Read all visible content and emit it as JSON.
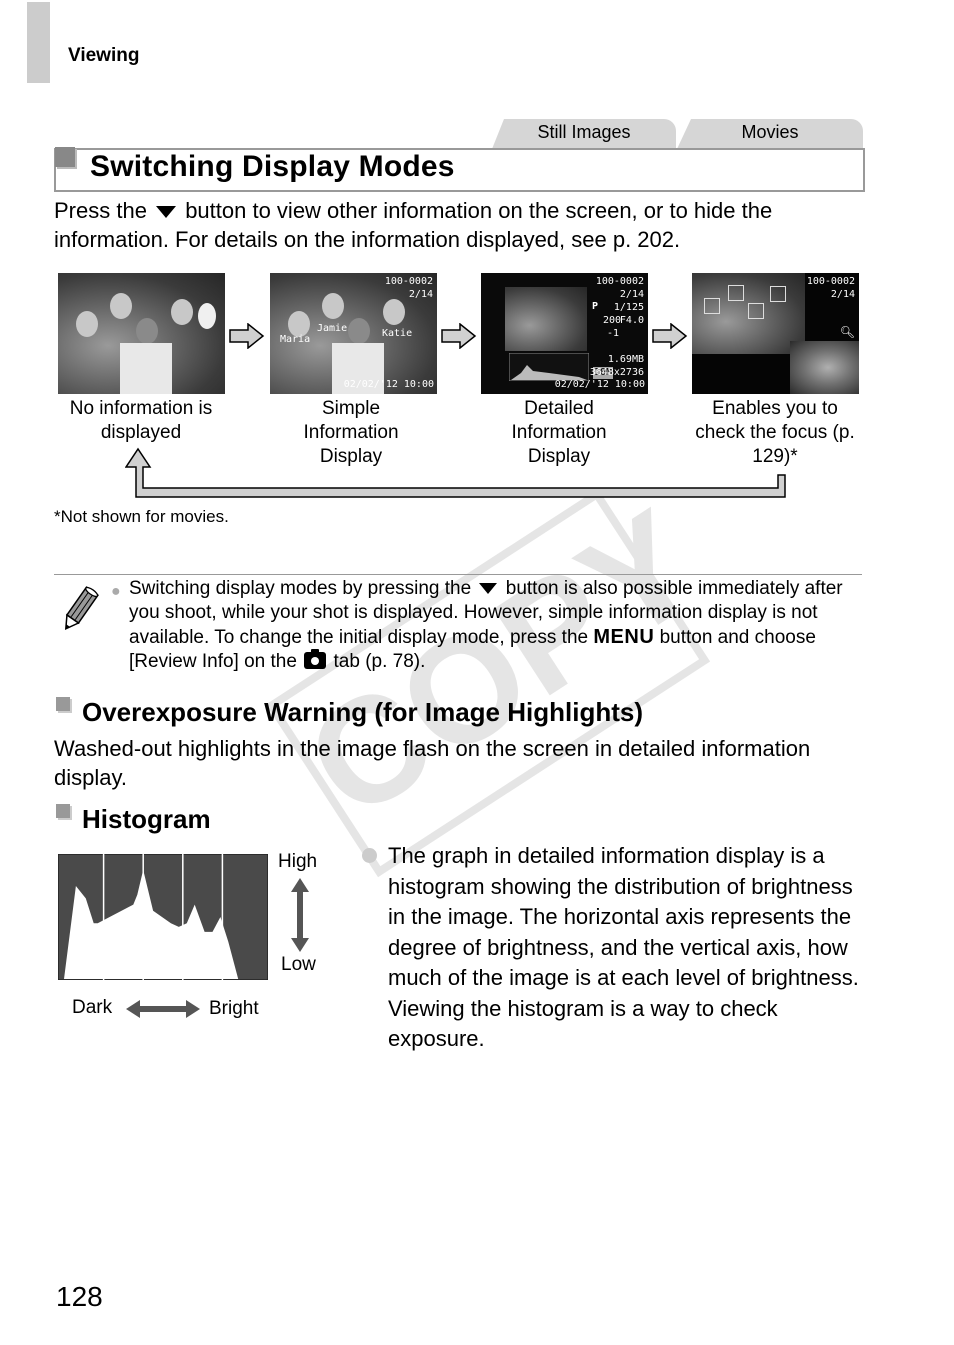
{
  "header": {
    "chapter": "Viewing"
  },
  "tabs": [
    {
      "label": "Still Images"
    },
    {
      "label": "Movies"
    }
  ],
  "section": {
    "title": "Switching Display Modes",
    "intro_before_icon": "Press the",
    "intro_after_icon": "button to view other information on the screen, or to hide the information. For details on the information displayed, see p. 202."
  },
  "display_modes": [
    {
      "caption": "No information is displayed",
      "overlay": {}
    },
    {
      "caption": "Simple Information Display",
      "overlay": {
        "file_number": "100-0002",
        "image_count": "2/14",
        "names": [
          "Maria",
          "Jamie",
          "Katie"
        ],
        "datetime": "02/02/'12  10:00"
      }
    },
    {
      "caption": "Detailed Information Display",
      "overlay": {
        "file_number": "100-0002",
        "image_count": "2/14",
        "mode": "P",
        "shutter": "1/125",
        "iso": "200",
        "aperture": "F4.0",
        "exposure_comp": "-1",
        "file_size": "1.69MB",
        "resolution_badge": "10M",
        "resolution": "3648x2736",
        "datetime": "02/02/'12  10:00"
      }
    },
    {
      "caption": "Enables you to check the focus (p. 129)*",
      "overlay": {
        "file_number": "100-0002",
        "image_count": "2/14"
      }
    }
  ],
  "footnote": "*Not shown for movies.",
  "note": {
    "icon": "pencil-icon",
    "text_1": "Switching display modes by pressing the",
    "text_2": "button is also possible immediately after you shoot, while your shot is displayed. However, simple information display is not available. To change the initial display mode, press the",
    "menu_label": "MENU",
    "text_3": "button and choose [Review Info] on the",
    "text_4": "tab (p. 78)."
  },
  "overexposure": {
    "heading": "Overexposure Warning (for Image Highlights)",
    "body": "Washed-out highlights in the image flash on the screen in detailed information display."
  },
  "histogram": {
    "heading": "Histogram",
    "label_high": "High",
    "label_low": "Low",
    "label_dark": "Dark",
    "label_bright": "Bright",
    "description": "The graph in detailed information display is a histogram showing the distribution of brightness in the image. The horizontal axis represents the degree of brightness, and the vertical axis, how much of the image is at each level of brightness. Viewing the histogram is a way to check exposure."
  },
  "chart_data": {
    "type": "area",
    "title": "Histogram",
    "xlabel": "Dark ↔ Bright",
    "ylabel": "Low ↔ High",
    "x": [
      0,
      0.06,
      0.11,
      0.15,
      0.17,
      0.35,
      0.37,
      0.4,
      0.45,
      0.54,
      0.58,
      0.62,
      0.66,
      0.71,
      0.75,
      0.79,
      0.83,
      0.88,
      1.0
    ],
    "values": [
      0,
      0.75,
      0.65,
      0.45,
      0.45,
      0.6,
      0.68,
      0.88,
      0.55,
      0.45,
      0.42,
      0.45,
      0.6,
      0.38,
      0.38,
      0.5,
      0.3,
      0,
      0
    ],
    "xlim": [
      0,
      1
    ],
    "ylim": [
      0,
      1
    ],
    "grid": true,
    "gridlines_x": [
      0.2,
      0.4,
      0.6,
      0.8
    ]
  },
  "page_number": "128",
  "watermark": "COPY"
}
